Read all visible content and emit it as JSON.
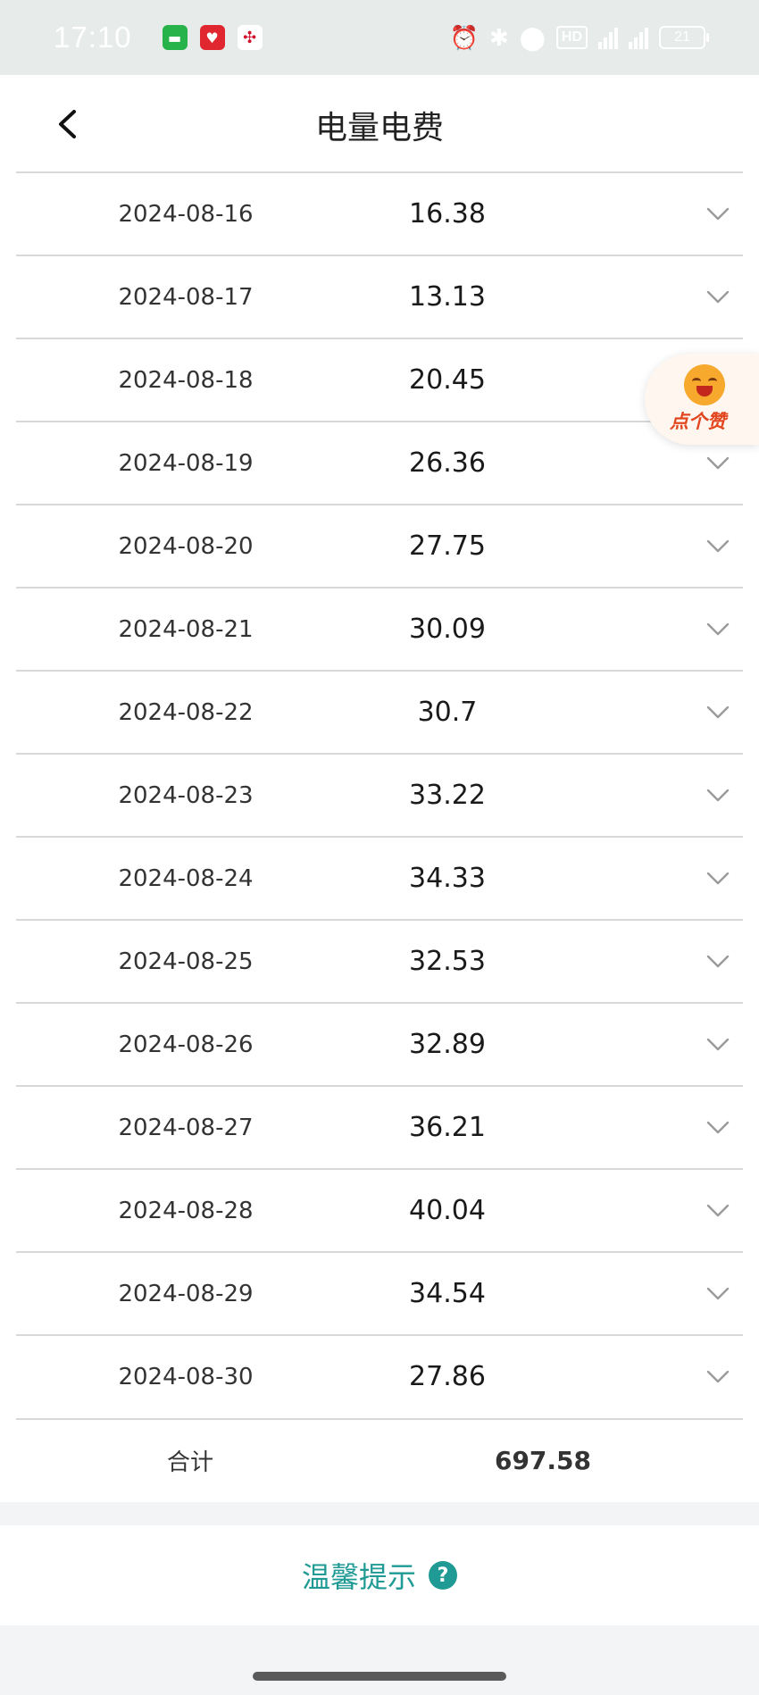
{
  "status_bar": {
    "time": "17:10",
    "hd_label": "HD",
    "battery": "21"
  },
  "header": {
    "title": "电量电费"
  },
  "rows": [
    {
      "date": "2024-08-16",
      "amount": "16.38"
    },
    {
      "date": "2024-08-17",
      "amount": "13.13"
    },
    {
      "date": "2024-08-18",
      "amount": "20.45"
    },
    {
      "date": "2024-08-19",
      "amount": "26.36"
    },
    {
      "date": "2024-08-20",
      "amount": "27.75"
    },
    {
      "date": "2024-08-21",
      "amount": "30.09"
    },
    {
      "date": "2024-08-22",
      "amount": "30.7"
    },
    {
      "date": "2024-08-23",
      "amount": "33.22"
    },
    {
      "date": "2024-08-24",
      "amount": "34.33"
    },
    {
      "date": "2024-08-25",
      "amount": "32.53"
    },
    {
      "date": "2024-08-26",
      "amount": "32.89"
    },
    {
      "date": "2024-08-27",
      "amount": "36.21"
    },
    {
      "date": "2024-08-28",
      "amount": "40.04"
    },
    {
      "date": "2024-08-29",
      "amount": "34.54"
    },
    {
      "date": "2024-08-30",
      "amount": "27.86"
    }
  ],
  "total": {
    "label": "合计",
    "value": "697.58"
  },
  "tips": {
    "label": "温馨提示",
    "help_icon": "?"
  },
  "like_button": {
    "label": "点个赞"
  },
  "colors": {
    "accent": "#1f9a94",
    "like": "#e2461f"
  }
}
